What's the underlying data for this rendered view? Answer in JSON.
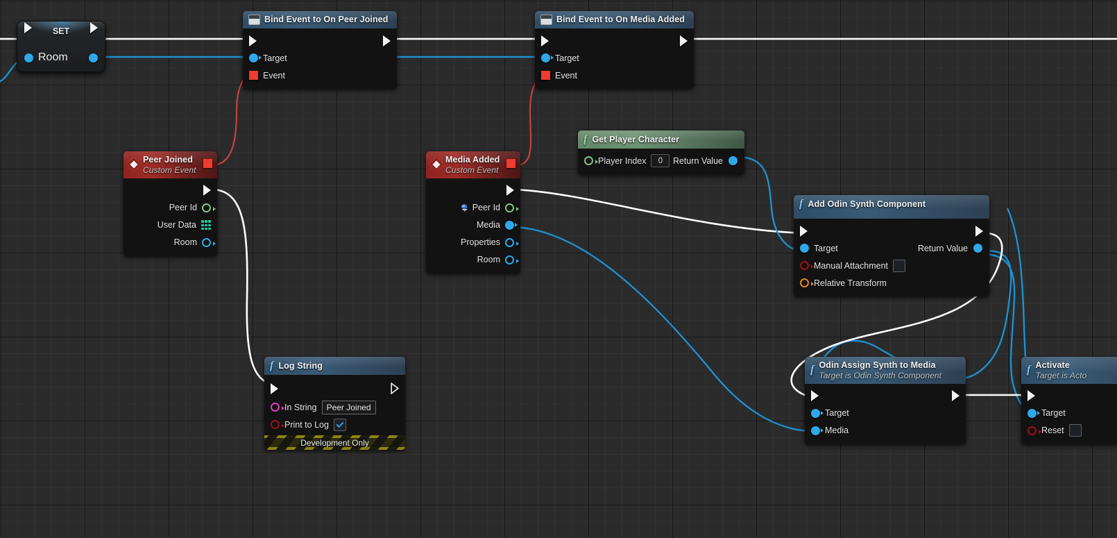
{
  "app": {
    "context": "unreal-engine-blueprint-event-graph",
    "background_color": "#2b2b2b"
  },
  "colors": {
    "exec_wire": "#ffffff",
    "object_wire": "#1f8fd0",
    "delegate_wire": "#c9413c",
    "object_pin": "#2fa8e8",
    "int_pin": "#8fd38f",
    "bool_pin": "#b40f0f",
    "string_pin": "#e23fbb",
    "struct_pin": "#e08a1e",
    "map_pin": "#1ec8a8",
    "delegate_pin": "#f03b30",
    "title_blue": "#395a75",
    "title_green": "#6d9173",
    "title_red": "#a02b26",
    "hazard_yellow": "#8a8616"
  },
  "nodes": {
    "set_room": {
      "title": "SET",
      "icon": "set-variable-node",
      "exec_in": "",
      "exec_out": "",
      "pins_in": [
        {
          "label": "Room",
          "type": "object",
          "shape": "filled"
        }
      ],
      "pins_out": [
        {
          "label": "",
          "type": "object",
          "shape": "filled"
        }
      ]
    },
    "bind_peer_joined": {
      "title": "Bind Event to On Peer Joined",
      "icon": "delegate-icon",
      "pins_in": [
        {
          "label": "Target",
          "type": "object",
          "shape": "filled"
        },
        {
          "label": "Event",
          "type": "delegate",
          "shape": "square"
        }
      ],
      "pins_out": []
    },
    "bind_media_added": {
      "title": "Bind Event to On Media Added",
      "icon": "delegate-icon",
      "pins_in": [
        {
          "label": "Target",
          "type": "object",
          "shape": "filled"
        },
        {
          "label": "Event",
          "type": "delegate",
          "shape": "square"
        }
      ],
      "pins_out": []
    },
    "peer_joined_event": {
      "title": "Peer Joined",
      "subtitle": "Custom Event",
      "icon": "custom-event-icon",
      "delegate_pin": true,
      "pins_out": [
        {
          "label": "Peer Id",
          "type": "int",
          "shape": "hollow",
          "watch": false
        },
        {
          "label": "User Data",
          "type": "map",
          "shape": "map",
          "watch": false
        },
        {
          "label": "Room",
          "type": "object",
          "shape": "hollow",
          "watch": false
        }
      ]
    },
    "media_added_event": {
      "title": "Media Added",
      "subtitle": "Custom Event",
      "icon": "custom-event-icon",
      "delegate_pin": true,
      "pins_out": [
        {
          "label": "Peer Id",
          "type": "int",
          "shape": "hollow",
          "watch": true
        },
        {
          "label": "Media",
          "type": "object",
          "shape": "filled",
          "watch": false
        },
        {
          "label": "Properties",
          "type": "object",
          "shape": "hollow",
          "watch": false
        },
        {
          "label": "Room",
          "type": "object",
          "shape": "hollow",
          "watch": false
        }
      ]
    },
    "get_player_character": {
      "title": "Get Player Character",
      "icon": "pure-function-icon",
      "pins_in": [
        {
          "label": "Player Index",
          "type": "int",
          "shape": "hollow",
          "value": "0"
        }
      ],
      "pins_out": [
        {
          "label": "Return Value",
          "type": "object",
          "shape": "filled"
        }
      ]
    },
    "add_odin_synth_component": {
      "title": "Add Odin Synth Component",
      "icon": "function-icon",
      "pins_in": [
        {
          "label": "Target",
          "type": "object",
          "shape": "filled"
        },
        {
          "label": "Manual Attachment",
          "type": "bool",
          "shape": "hollow",
          "checked": false
        },
        {
          "label": "Relative Transform",
          "type": "struct",
          "shape": "hollow"
        }
      ],
      "pins_out": [
        {
          "label": "Return Value",
          "type": "object",
          "shape": "filled"
        }
      ]
    },
    "odin_assign_synth_to_media": {
      "title": "Odin Assign Synth to Media",
      "subtitle": "Target is Odin Synth Component",
      "icon": "function-icon",
      "pins_in": [
        {
          "label": "Target",
          "type": "object",
          "shape": "filled"
        },
        {
          "label": "Media",
          "type": "object",
          "shape": "filled"
        }
      ],
      "pins_out": []
    },
    "activate": {
      "title": "Activate",
      "subtitle": "Target is Acto",
      "icon": "function-icon",
      "pins_in": [
        {
          "label": "Target",
          "type": "object",
          "shape": "filled"
        },
        {
          "label": "Reset",
          "type": "bool",
          "shape": "hollow",
          "checked": false
        }
      ],
      "pins_out": []
    },
    "log_string": {
      "title": "Log String",
      "icon": "function-icon",
      "pins_in": [
        {
          "label": "In String",
          "type": "string",
          "shape": "hollow",
          "value": "Peer Joined"
        },
        {
          "label": "Print to Log",
          "type": "bool",
          "shape": "hollow",
          "checked": true
        }
      ],
      "pins_out": [],
      "footer": "Development Only"
    }
  }
}
